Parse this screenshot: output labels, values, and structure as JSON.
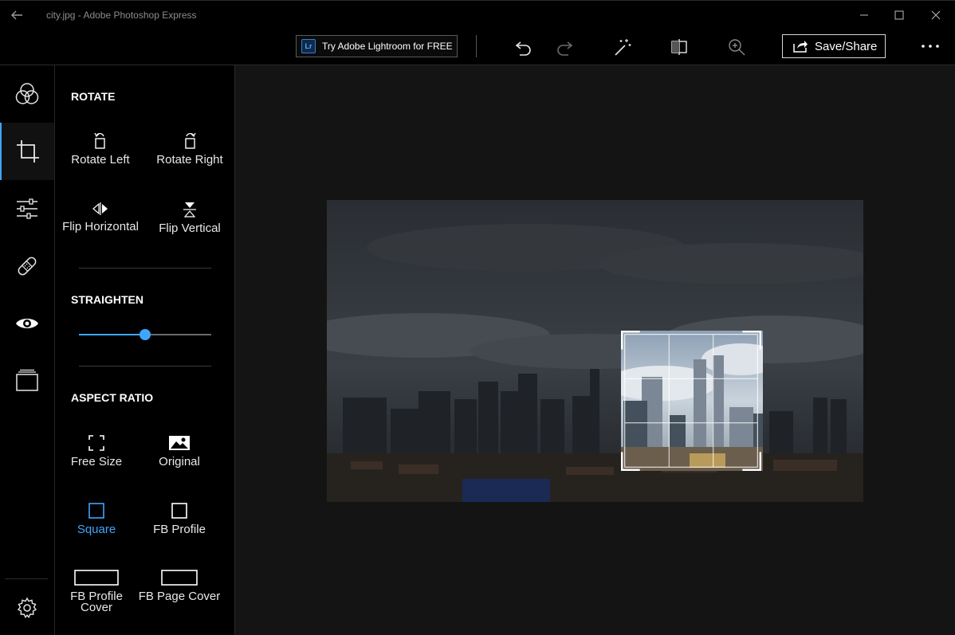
{
  "window": {
    "title": "city.jpg - Adobe Photoshop Express"
  },
  "toolbar": {
    "lightroom_badge": "Lr",
    "lightroom_label": "Try Adobe Lightroom for FREE",
    "save_label": "Save/Share"
  },
  "panel": {
    "rotate": {
      "title": "ROTATE",
      "rotate_left": "Rotate Left",
      "rotate_right": "Rotate Right",
      "flip_horizontal": "Flip Horizontal",
      "flip_vertical": "Flip Vertical"
    },
    "straighten": {
      "title": "STRAIGHTEN",
      "value_fraction": 0.5
    },
    "aspect_ratio": {
      "title": "ASPECT RATIO",
      "options": [
        {
          "label": "Free Size",
          "selected": false
        },
        {
          "label": "Original",
          "selected": false
        },
        {
          "label": "Square",
          "selected": true
        },
        {
          "label": "FB Profile",
          "selected": false
        },
        {
          "label": "FB Profile Cover",
          "selected": false
        },
        {
          "label": "FB Page Cover",
          "selected": false
        }
      ]
    }
  },
  "rail": {
    "items": [
      {
        "icon": "looks-icon",
        "active": false
      },
      {
        "icon": "crop-icon",
        "active": true
      },
      {
        "icon": "adjustments-icon",
        "active": false
      },
      {
        "icon": "heal-icon",
        "active": false
      },
      {
        "icon": "eye-icon",
        "active": false
      },
      {
        "icon": "borders-icon",
        "active": false
      },
      {
        "icon": "settings-gear-icon",
        "active": false
      }
    ]
  },
  "colors": {
    "accent": "#3ea6ff",
    "background": "#000000",
    "canvas": "#141414"
  }
}
